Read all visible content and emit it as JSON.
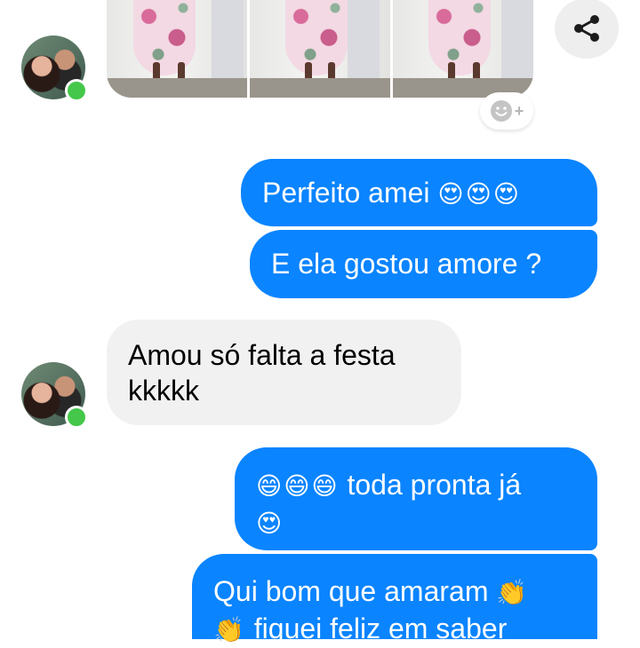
{
  "header": {
    "share_icon": "share-icon",
    "react_icon": "add-reaction-icon"
  },
  "avatar": {
    "icon": "contact-avatar",
    "online_color": "#44c74a"
  },
  "colors": {
    "sent_bubble": "#0a84ff",
    "received_bubble": "#f1f1f1"
  },
  "messages": [
    {
      "from": "me",
      "text": "Perfeito amei",
      "emoji": "😍😍😍"
    },
    {
      "from": "me",
      "text": "E ela gostou amore ?"
    },
    {
      "from": "contact",
      "line1": "Amou só falta a festa",
      "line2": "kkkkk"
    },
    {
      "from": "me",
      "emoji1": "😄😄😄",
      "text1": "toda pronta já",
      "emoji2": "😍"
    },
    {
      "from": "me",
      "text1": "Qui bom que amaram",
      "emoji1": "👏",
      "emoji2": "👏",
      "text2": "fiquei feliz em saber"
    }
  ]
}
